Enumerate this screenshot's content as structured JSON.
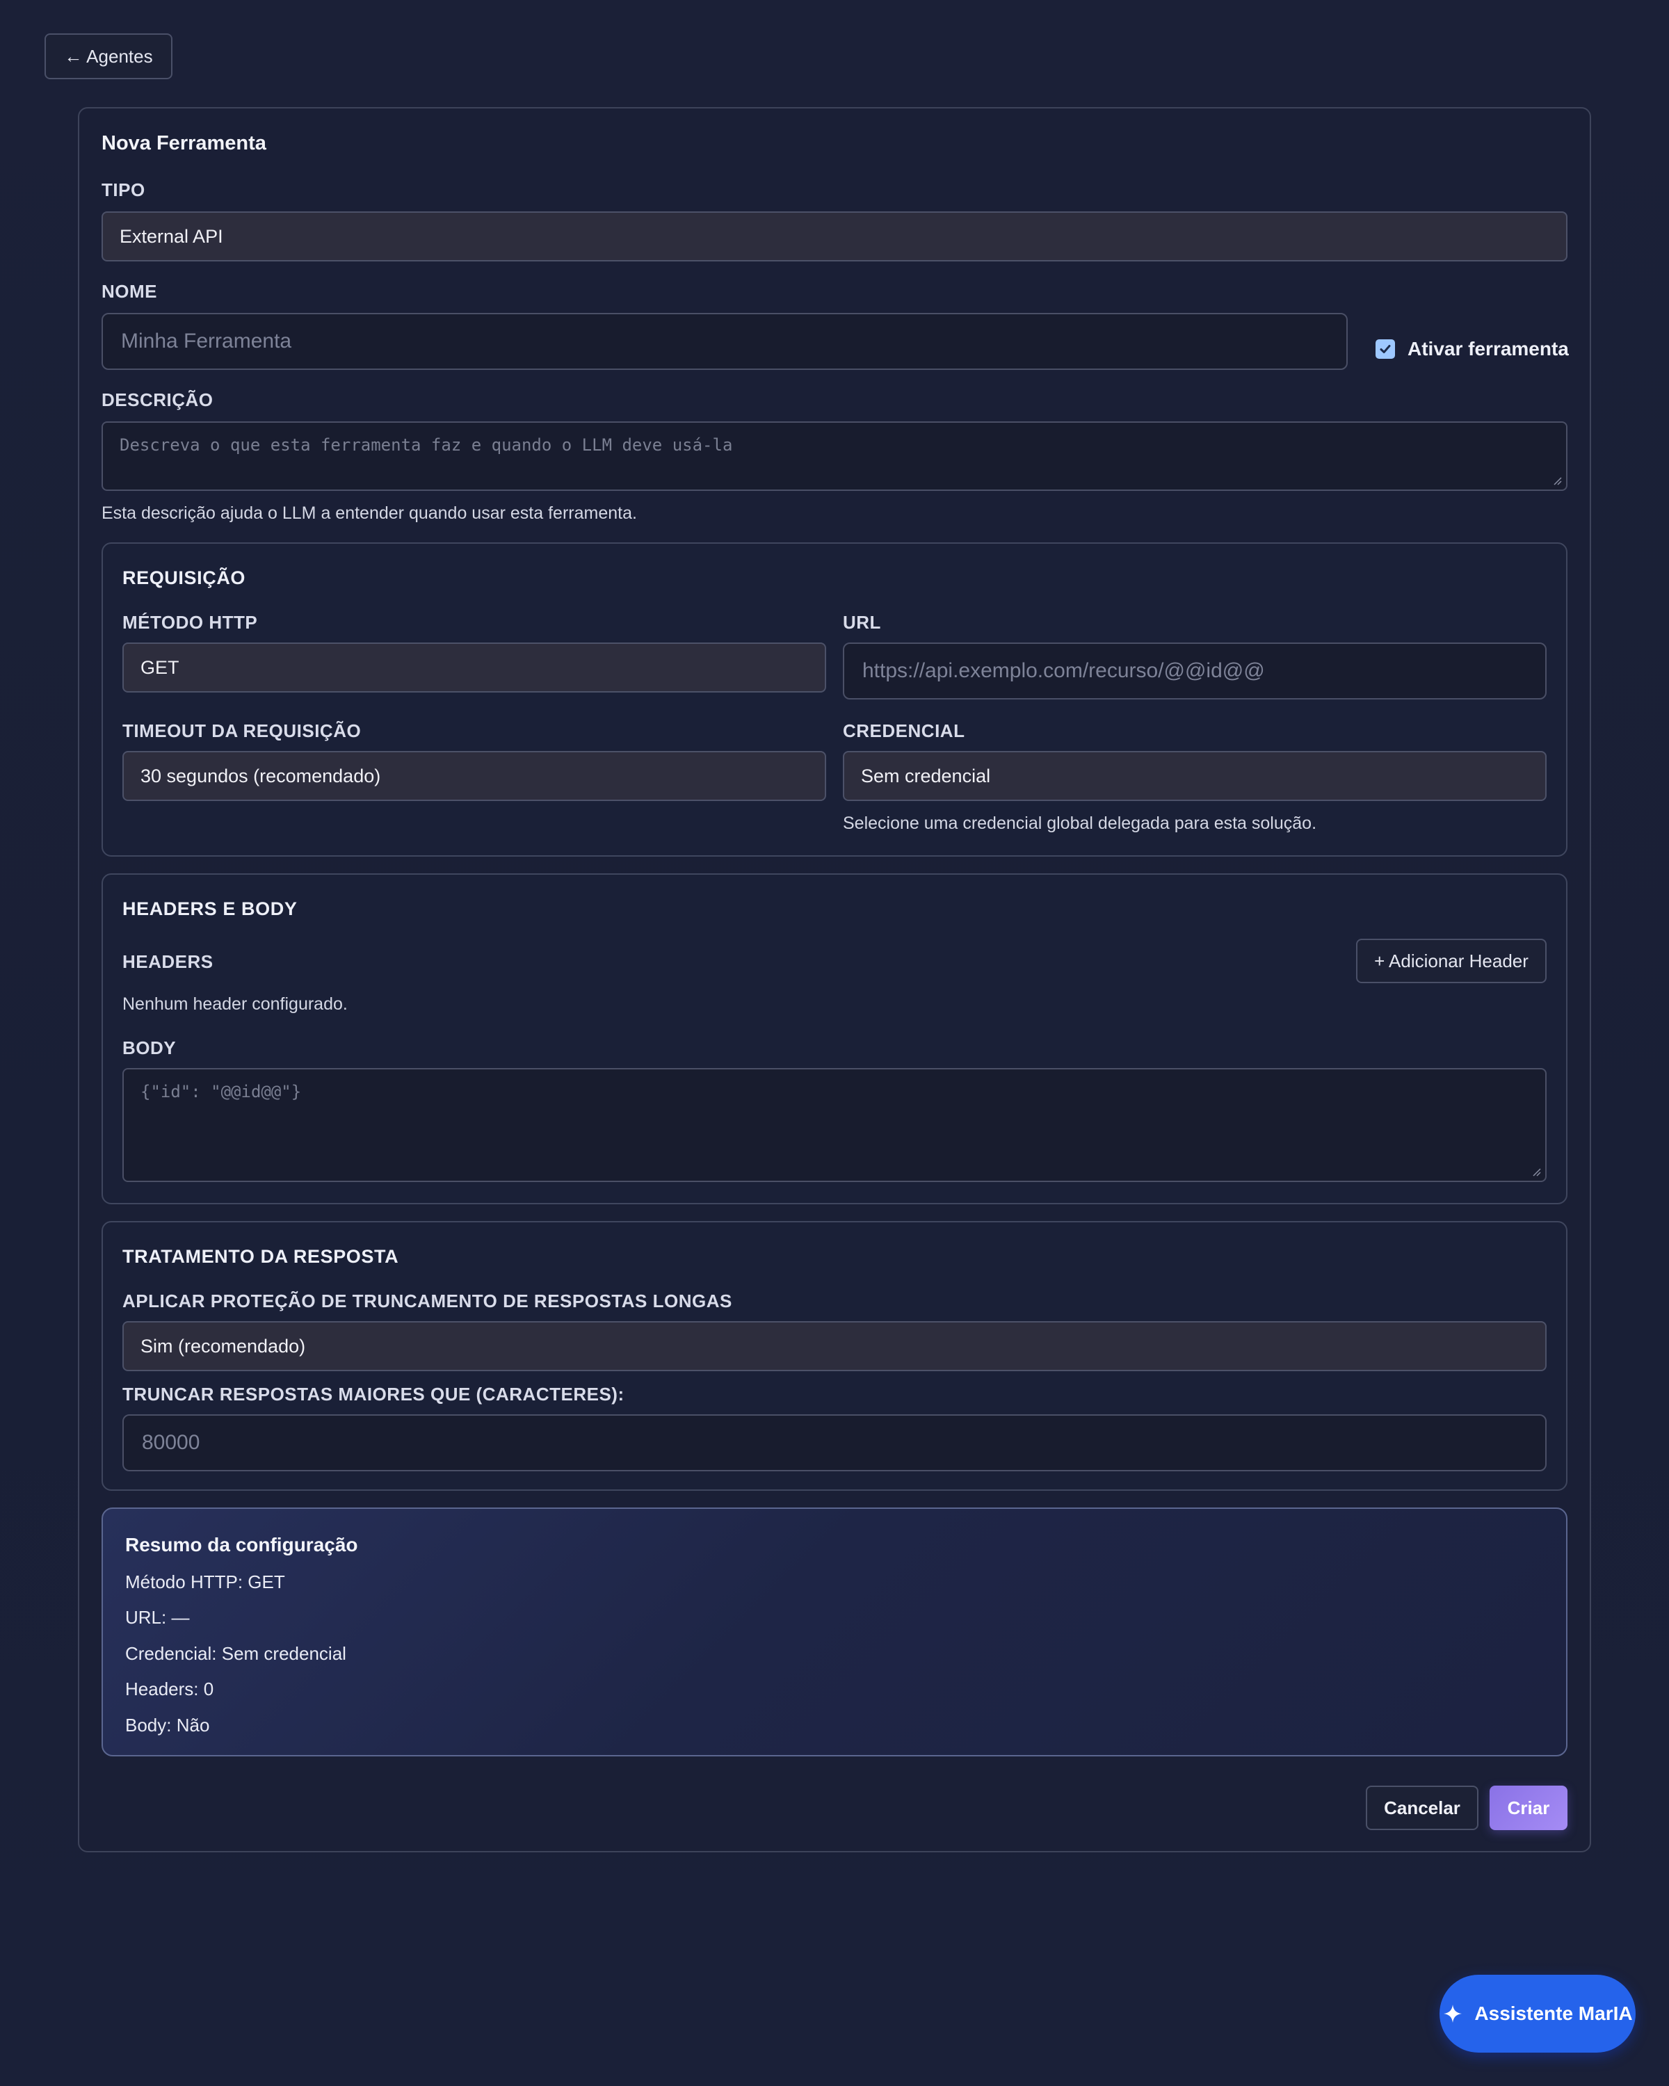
{
  "nav": {
    "back_label": "← Agentes"
  },
  "form": {
    "title": "Nova Ferramenta",
    "tipo": {
      "label": "TIPO",
      "value": "External API"
    },
    "nome": {
      "label": "NOME",
      "placeholder": "Minha Ferramenta"
    },
    "ativar": {
      "label": "Ativar ferramenta",
      "checked": true
    },
    "descricao": {
      "label": "DESCRIÇÃO",
      "placeholder": "Descreva o que esta ferramenta faz e quando o LLM deve usá-la",
      "helper": "Esta descrição ajuda o LLM a entender quando usar esta ferramenta."
    }
  },
  "requisicao": {
    "title": "REQUISIÇÃO",
    "metodo": {
      "label": "MÉTODO HTTP",
      "value": "GET"
    },
    "url": {
      "label": "URL",
      "placeholder": "https://api.exemplo.com/recurso/@@id@@"
    },
    "timeout": {
      "label": "TIMEOUT DA REQUISIÇÃO",
      "value": "30 segundos (recomendado)"
    },
    "credencial": {
      "label": "CREDENCIAL",
      "value": "Sem credencial",
      "helper": "Selecione uma credencial global delegada para esta solução."
    }
  },
  "headers_body": {
    "title": "HEADERS E BODY",
    "headers_label": "HEADERS",
    "add_header_label": "+ Adicionar Header",
    "empty_headers": "Nenhum header configurado.",
    "body_label": "BODY",
    "body_placeholder": "{\"id\": \"@@id@@\"}"
  },
  "resposta": {
    "title": "TRATAMENTO DA RESPOSTA",
    "protecao": {
      "label": "APLICAR PROTEÇÃO DE TRUNCAMENTO DE RESPOSTAS LONGAS",
      "value": "Sim (recomendado)"
    },
    "truncar": {
      "label": "TRUNCAR RESPOSTAS MAIORES QUE (CARACTERES):",
      "placeholder": "80000"
    }
  },
  "summary": {
    "title": "Resumo da configuração",
    "lines": [
      "Método HTTP: GET",
      "URL: —",
      "Credencial: Sem credencial",
      "Headers: 0",
      "Body: Não"
    ]
  },
  "actions": {
    "cancel_label": "Cancelar",
    "create_label": "Criar"
  },
  "assistant": {
    "label": "Assistente MarIA",
    "icon": "sparkle-icon"
  },
  "colors": {
    "accent": "#2563eb",
    "create": "#9a82f0",
    "checkbox": "#9ec8ff"
  }
}
